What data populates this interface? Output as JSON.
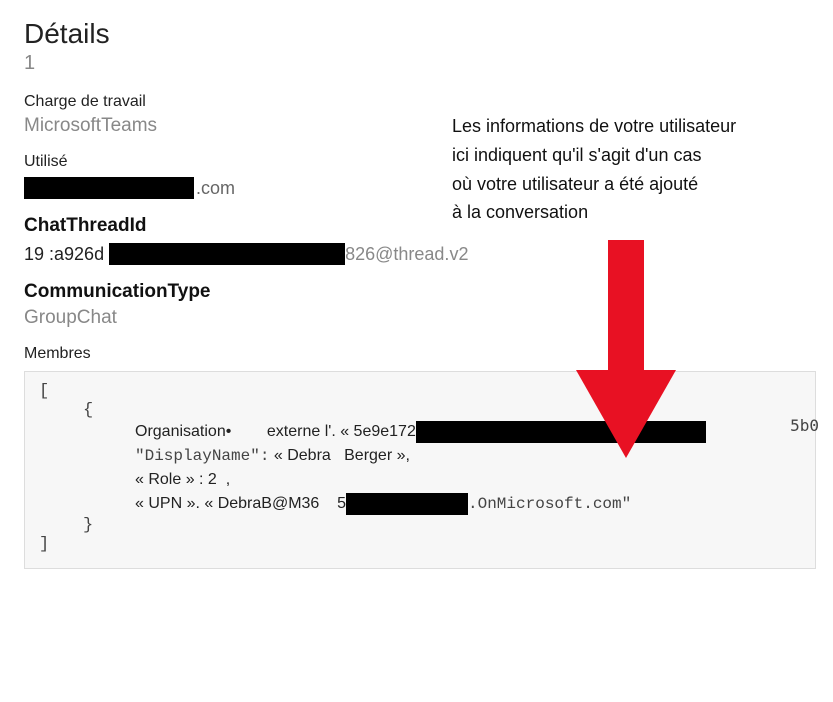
{
  "heading": {
    "title": "Détails",
    "count": "1"
  },
  "workload": {
    "label": "Charge de travail",
    "value": "MicrosoftTeams"
  },
  "used": {
    "label": "Utilisé",
    "suffix": ".com"
  },
  "chatThread": {
    "label": "ChatThreadId",
    "prefix": "19 :a926d",
    "suffix": "826@thread.v2"
  },
  "commType": {
    "label": "CommunicationType",
    "value": "GroupChat"
  },
  "members": {
    "label": "Membres"
  },
  "annotation": {
    "l1": "Les informations de votre utilisateur",
    "l2": "ici indiquent qu'il s'agit d'un cas",
    "l3": "où votre utilisateur a été ajouté",
    "l4": "à la conversation"
  },
  "code": {
    "open_sq": "[",
    "open_br": "{",
    "org_label": "Organisation•",
    "org_ext": "externe l'. « 5e9e172",
    "org_overflow": "5b0",
    "displayname_key": "\"DisplayName\":",
    "displayname_val": " « Debra   Berger »,",
    "role": "« Role » : 2  ,",
    "upn_prefix": "« UPN ». « DebraB@M36    5",
    "upn_suffix": ".OnMicrosoft.com\"",
    "close_br": "}",
    "close_sq": "]"
  }
}
